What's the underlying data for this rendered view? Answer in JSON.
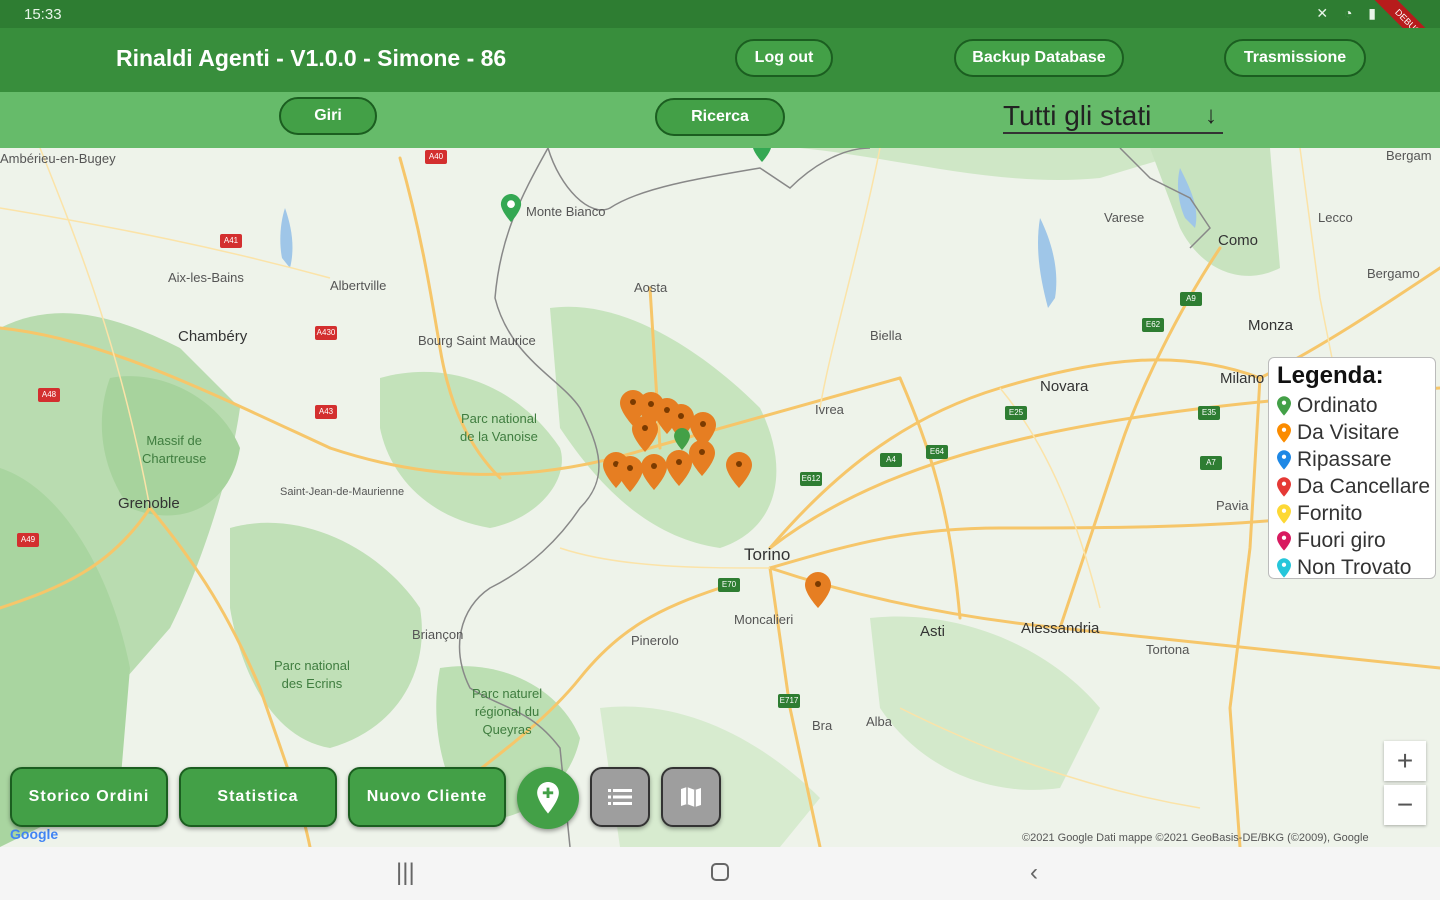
{
  "status_bar": {
    "time": "15:33",
    "icons": "✕ ◔ ▮",
    "debug_label": "DEBUG"
  },
  "appbar": {
    "title": "Rinaldi Agenti  -   V1.0.0  -  Simone  -  86",
    "logout_label": "Log out",
    "backup_label": "Backup Database",
    "transmission_label": "Trasmissione"
  },
  "subbar": {
    "giri_label": "Giri",
    "search_label": "Ricerca",
    "status_filter": "Tutti gli stati"
  },
  "map": {
    "places": [
      "Monte Bianco",
      "Aosta",
      "Albertville",
      "Aix-les-Bains",
      "Chambéry",
      "Bourg Saint Maurice",
      "Biella",
      "Novara",
      "Ivrea",
      "Varese",
      "Como",
      "Lecco",
      "Bergamo",
      "Monza",
      "Milano",
      "Torino",
      "Moncalieri",
      "Pinerolo",
      "Briançon",
      "Asti",
      "Alessandria",
      "Tortona",
      "Pavia",
      "Bra",
      "Alba",
      "Grenoble",
      "Saint-Jean-de-Maurienne",
      "Bergam",
      "Ambérieu-en-Bugey"
    ],
    "parks": [
      "Parc national\nde la Vanoise",
      "Massif de\nChartreuse",
      "Parc national\ndes Ecrins",
      "Parc naturel\nrégional du\nQueyras"
    ],
    "copyright": "©2021 Google  Dati mappe ©2021 GeoBasis-DE/BKG (©2009), Google",
    "google": "Google"
  },
  "legend": {
    "title": "Legenda:",
    "items": [
      {
        "label": "Ordinato",
        "color": "#43a047"
      },
      {
        "label": "Da Visitare",
        "color": "#fb8c00"
      },
      {
        "label": "Ripassare",
        "color": "#1e88e5"
      },
      {
        "label": "Da Cancellare",
        "color": "#e53935"
      },
      {
        "label": "Fornito",
        "color": "#fdd835"
      },
      {
        "label": "Fuori giro",
        "color": "#d81b60"
      },
      {
        "label": "Non Trovato",
        "color": "#26c6da"
      }
    ]
  },
  "actions": {
    "history_label": "Storico Ordini",
    "stats_label": "Statistica",
    "new_client_label": "Nuovo Cliente"
  },
  "zoom": {
    "in": "+",
    "out": "−"
  },
  "colors": {
    "primary_dark": "#2e7d32",
    "primary": "#388e3c",
    "primary_light": "#66bb6a",
    "pin_orange": "#e67e22"
  }
}
